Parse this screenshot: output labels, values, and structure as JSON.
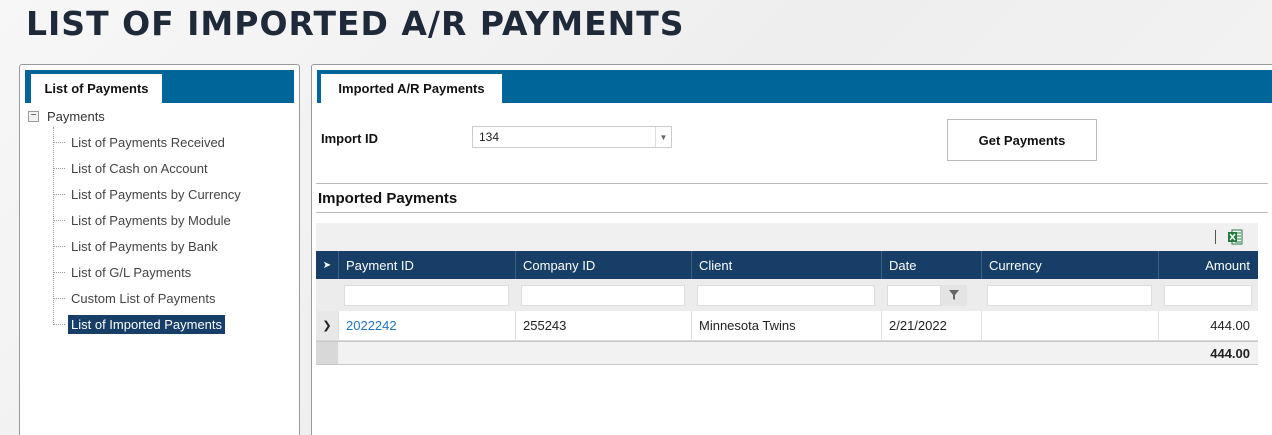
{
  "page": {
    "title": "LIST OF IMPORTED A/R PAYMENTS"
  },
  "left_panel": {
    "tab_label": "List of Payments",
    "tree": {
      "root_label": "Payments",
      "toggle_symbol": "−",
      "items": [
        {
          "label": "List of Payments Received",
          "selected": false
        },
        {
          "label": "List of Cash on Account",
          "selected": false
        },
        {
          "label": "List of Payments by Currency",
          "selected": false
        },
        {
          "label": "List of Payments by Module",
          "selected": false
        },
        {
          "label": "List of Payments by Bank",
          "selected": false
        },
        {
          "label": "List of G/L Payments",
          "selected": false
        },
        {
          "label": "Custom List of Payments",
          "selected": false
        },
        {
          "label": "List of Imported Payments",
          "selected": true
        }
      ]
    }
  },
  "right_panel": {
    "tab_label": "Imported A/R Payments",
    "import": {
      "label": "Import ID",
      "value": "134"
    },
    "get_button_label": "Get Payments",
    "section_title": "Imported Payments",
    "grid": {
      "columns": [
        "Payment ID",
        "Company ID",
        "Client",
        "Date",
        "Currency",
        "Amount"
      ],
      "rows": [
        {
          "payment_id": "2022242",
          "company_id": "255243",
          "client": "Minnesota Twins",
          "date": "2/21/2022",
          "currency": "",
          "amount": "444.00"
        }
      ],
      "total_amount": "444.00"
    }
  },
  "icons": {
    "tree_toggle": "minus-box-icon",
    "dropdown": "chevron-down-icon",
    "filter": "funnel-icon",
    "excel": "excel-export-icon",
    "row_expand": "chevron-right-icon"
  },
  "colors": {
    "header_blue": "#006699",
    "grid_header_navy": "#163e66",
    "link_blue": "#1e73be",
    "excel_green": "#1f7a3a"
  }
}
